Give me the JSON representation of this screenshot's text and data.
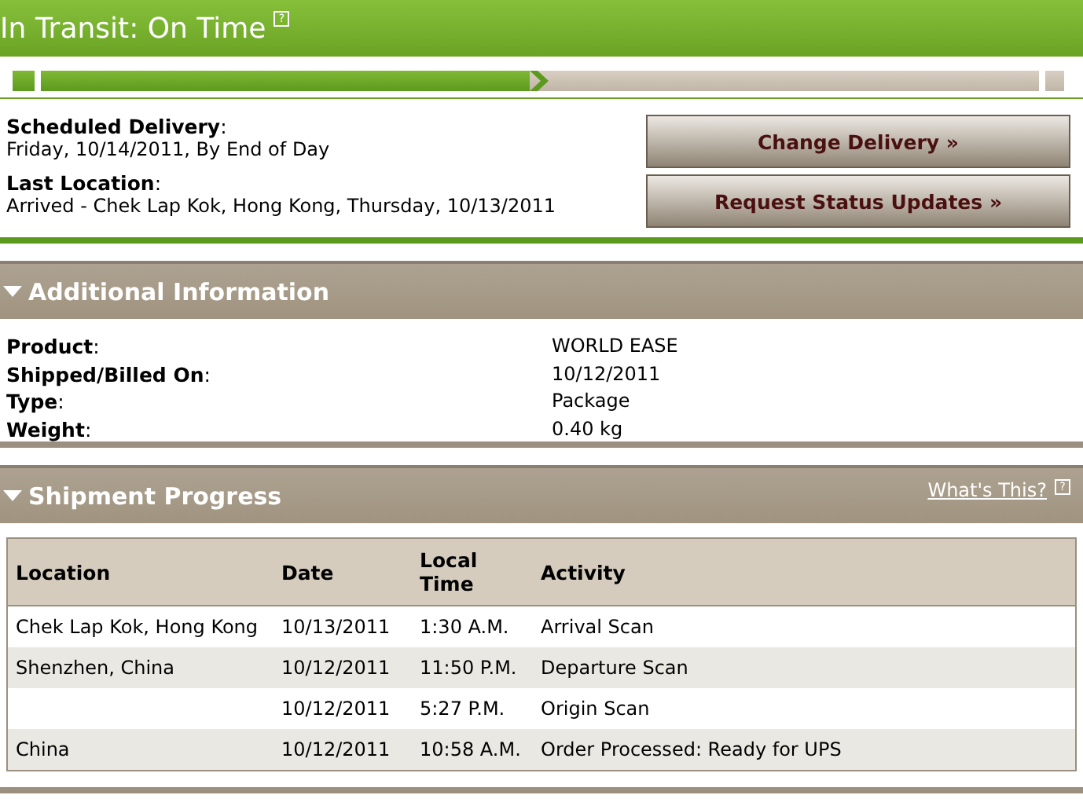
{
  "status": {
    "title": "In Transit: On Time",
    "help": "?",
    "progress": {
      "level": 0.49
    }
  },
  "summary": [
    {
      "label": "**Scheduled Delivery**:",
      "value": "Friday, 10/14/2011, By End of Day"
    },
    {
      "label": "**Last Location**:",
      "value": "Arrived - Chek Lap Kok, Hong Kong, Thursday, 10/13/2011"
    }
  ],
  "buttons": [
    "Change Delivery »",
    "Request Status Updates »"
  ],
  "additional_information": {
    "title": "Additional Information",
    "expanded": true,
    "fields": [
      {
        "label": "**Product**:",
        "value": "WORLD EASE"
      },
      {
        "label": "**Shipped/Billed On**:",
        "value": "10/12/2011"
      },
      {
        "label": "**Type**:",
        "value": "Package"
      },
      {
        "label": "**Weight**:",
        "value": "0.40 kg"
      }
    ]
  },
  "shipment_progress": {
    "title": "Shipment Progress",
    "expanded": true,
    "help_link": "What's This?",
    "help": "?",
    "table": {
      "columns": [
        "Location",
        "Date",
        "Local Time",
        "Activity"
      ],
      "rows": [
        [
          "Chek Lap Kok, Hong Kong",
          "10/13/2011",
          "1:30 A.M.",
          "Arrival Scan"
        ],
        [
          "Shenzhen, China",
          "10/12/2011",
          "11:50 P.M.",
          "Departure Scan"
        ],
        [
          "",
          "10/12/2011",
          "5:27 P.M.",
          "Origin Scan"
        ],
        [
          "China",
          "10/12/2011",
          "10:58 A.M.",
          "Order Processed: Ready for UPS"
        ]
      ]
    }
  }
}
